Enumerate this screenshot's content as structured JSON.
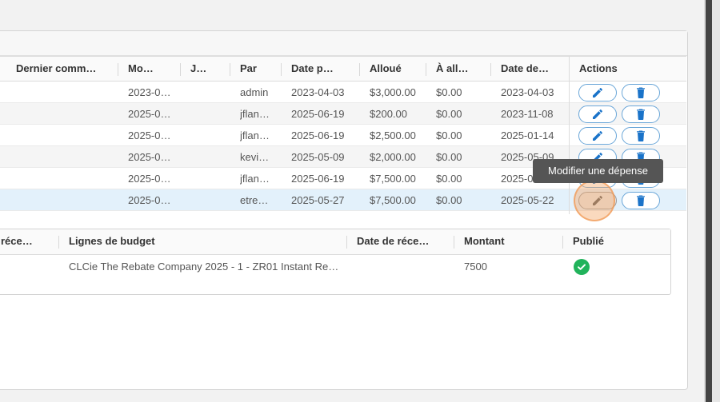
{
  "main_table": {
    "columns": [
      "Dernier comm…",
      "Mo…",
      "J…",
      "Par",
      "Date p…",
      "Alloué",
      "À all…",
      "Date de…",
      "Actions"
    ],
    "rows": [
      {
        "mo": "2023-0…",
        "j": "",
        "par": "admin",
        "date_p": "2023-04-03",
        "alloue": "$3,000.00",
        "a_all": "$0.00",
        "date_de": "2023-04-03"
      },
      {
        "mo": "2025-0…",
        "j": "",
        "par": "jflan…",
        "date_p": "2025-06-19",
        "alloue": "$200.00",
        "a_all": "$0.00",
        "date_de": "2023-11-08"
      },
      {
        "mo": "2025-0…",
        "j": "",
        "par": "jflan…",
        "date_p": "2025-06-19",
        "alloue": "$2,500.00",
        "a_all": "$0.00",
        "date_de": "2025-01-14"
      },
      {
        "mo": "2025-0…",
        "j": "",
        "par": "kevi…",
        "date_p": "2025-05-09",
        "alloue": "$2,000.00",
        "a_all": "$0.00",
        "date_de": "2025-05-09"
      },
      {
        "mo": "2025-0…",
        "j": "",
        "par": "jflan…",
        "date_p": "2025-06-19",
        "alloue": "$7,500.00",
        "a_all": "$0.00",
        "date_de": "2025-05-19"
      },
      {
        "mo": "2025-0…",
        "j": "",
        "par": "etre…",
        "date_p": "2025-05-27",
        "alloue": "$7,500.00",
        "a_all": "$0.00",
        "date_de": "2025-05-22"
      }
    ],
    "edit_icon": "pencil-icon",
    "delete_icon": "trash-icon"
  },
  "tooltip": {
    "text": "Modifier une dépense"
  },
  "sub_table": {
    "columns": [
      "réce…",
      "Lignes de budget",
      "Date de réce…",
      "Montant",
      "Publié"
    ],
    "rows": [
      {
        "ligne": "CLCie The Rebate Company 2025 - 1 - ZR01 Instant Re…",
        "date_rec": "",
        "montant": "7500",
        "publie_icon": "check-circle-icon"
      }
    ]
  },
  "colors": {
    "accent": "#1a73c9",
    "selected_row": "#e3f1fb",
    "published": "#21b35b",
    "focus": "#f3aa6e"
  }
}
